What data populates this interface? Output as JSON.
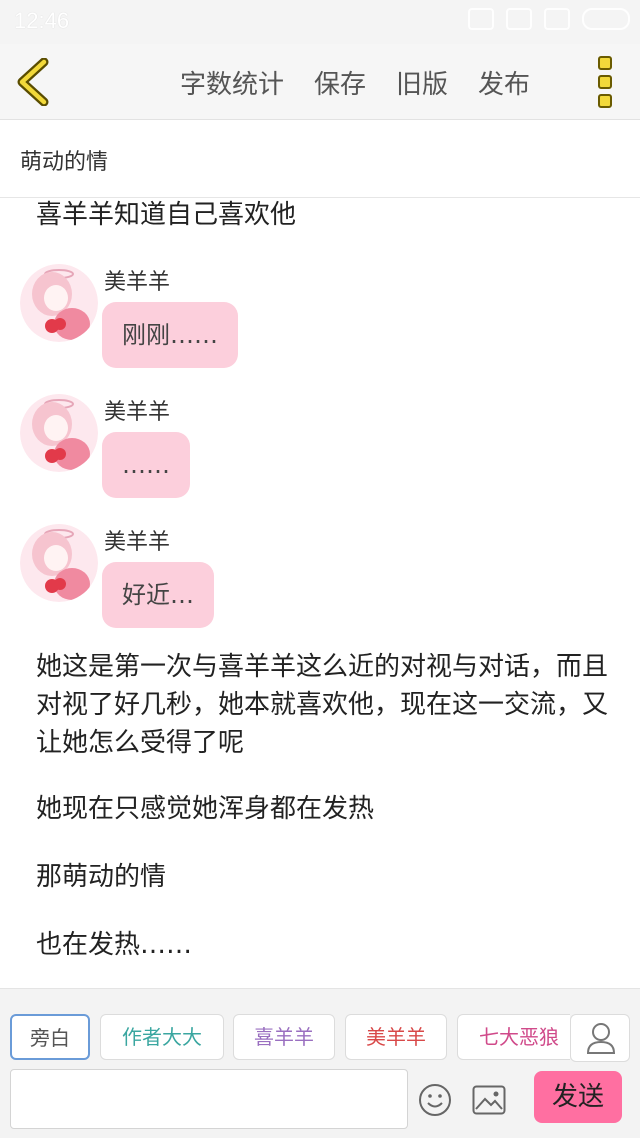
{
  "status_bar": {
    "time": "12:46"
  },
  "toolbar": {
    "word_count": "字数统计",
    "save": "保存",
    "old_version": "旧版",
    "publish": "发布"
  },
  "chapter": {
    "title": "萌动的情"
  },
  "story": {
    "intro": "喜羊羊知道自己喜欢他",
    "messages": [
      {
        "name": "美羊羊",
        "text": "刚刚……"
      },
      {
        "name": "美羊羊",
        "text": "……"
      },
      {
        "name": "美羊羊",
        "text": "好近…"
      }
    ],
    "paragraphs": [
      "她这是第一次与喜羊羊这么近的对视与对话，而且对视了好几秒，她本就喜欢他，现在这一交流，又让她怎么受得了呢",
      "她现在只感觉她浑身都在发热",
      "那萌动的情",
      "也在发热……"
    ]
  },
  "bottom_bar": {
    "roles": [
      {
        "label": "旁白",
        "color": "#555555"
      },
      {
        "label": "作者大大",
        "color": "#3aa6a0"
      },
      {
        "label": "喜羊羊",
        "color": "#9a6fc0"
      },
      {
        "label": "美羊羊",
        "color": "#d84848"
      },
      {
        "label": "七大恶狼",
        "color": "#d04a8a"
      }
    ],
    "send": "发送",
    "icons": [
      "user-icon",
      "emoji-icon",
      "image-icon"
    ]
  },
  "colors": {
    "bubble": "#fccfdc",
    "send_button": "#ff6fa1",
    "menu_accent": "#f2d93a"
  }
}
